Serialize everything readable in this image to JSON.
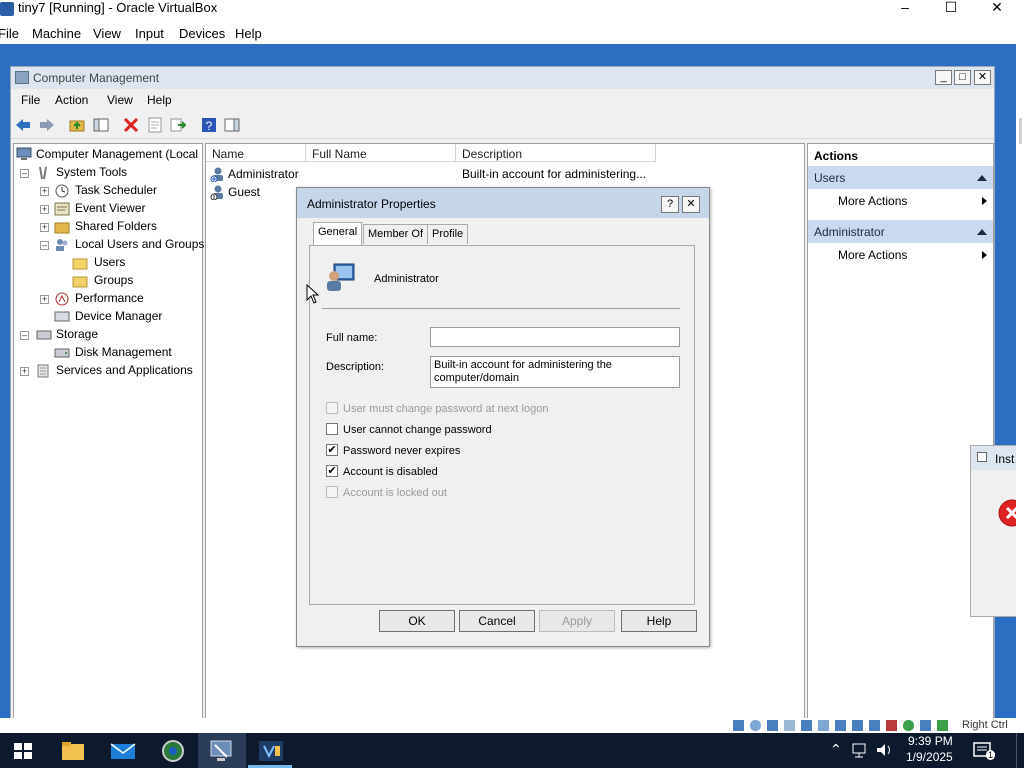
{
  "vbox": {
    "title": "tiny7 [Running] - Oracle VirtualBox",
    "menu": [
      "File",
      "Machine",
      "View",
      "Input",
      "Devices",
      "Help"
    ],
    "status_right": "Right Ctrl"
  },
  "cm": {
    "title": "Computer Management",
    "menu": [
      "File",
      "Action",
      "View",
      "Help"
    ],
    "tree": {
      "root": "Computer Management (Local",
      "system_tools": "System Tools",
      "task_scheduler": "Task Scheduler",
      "event_viewer": "Event Viewer",
      "shared_folders": "Shared Folders",
      "local_users_groups": "Local Users and Groups",
      "users": "Users",
      "groups": "Groups",
      "performance": "Performance",
      "device_manager": "Device Manager",
      "storage": "Storage",
      "disk_management": "Disk Management",
      "services_apps": "Services and Applications"
    },
    "list": {
      "columns": [
        "Name",
        "Full Name",
        "Description"
      ],
      "rows": [
        {
          "name": "Administrator",
          "full_name": "",
          "description": "Built-in account for administering..."
        },
        {
          "name": "Guest",
          "full_name": "",
          "description": ""
        }
      ]
    },
    "actions": {
      "header": "Actions",
      "section1": "Users",
      "section1_item": "More Actions",
      "section2": "Administrator",
      "section2_item": "More Actions"
    }
  },
  "dialog": {
    "title": "Administrator Properties",
    "help_btn": "?",
    "close_btn": "✕",
    "tabs": [
      "General",
      "Member Of",
      "Profile"
    ],
    "user_name": "Administrator",
    "full_name_label": "Full name:",
    "full_name_value": "",
    "description_label": "Description:",
    "description_value": "Built-in account for administering the computer/domain",
    "checkboxes": [
      {
        "label": "User must change password at next logon",
        "checked": false,
        "disabled": true
      },
      {
        "label": "User cannot change password",
        "checked": false,
        "disabled": false
      },
      {
        "label": "Password never expires",
        "checked": true,
        "disabled": false
      },
      {
        "label": "Account is disabled",
        "checked": true,
        "disabled": false
      },
      {
        "label": "Account is locked out",
        "checked": false,
        "disabled": true
      }
    ],
    "buttons": {
      "ok": "OK",
      "cancel": "Cancel",
      "apply": "Apply",
      "help": "Help"
    }
  },
  "partial_window_title": "Inst",
  "taskbar": {
    "time": "9:39 PM",
    "date": "1/9/2025",
    "notification_count": "1"
  },
  "colors": {
    "desktop": "#2b6ec2",
    "taskbar": "#0d1a2e",
    "actions_header": "#c9d9ef",
    "dialog_title": "#c5d6ea"
  }
}
